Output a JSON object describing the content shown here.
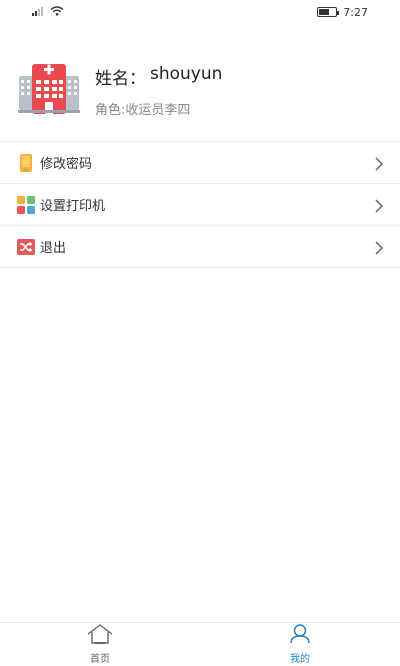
{
  "status_bar": {
    "time": "7:27",
    "signal_icon": "signal-icon",
    "wifi_icon": "wifi-icon",
    "battery_level": 0.6
  },
  "profile": {
    "avatar_icon": "hospital-icon",
    "name_label": "姓名：",
    "name_value": "shouyun",
    "role_text": "角色:收运员李四"
  },
  "menu": {
    "items": [
      {
        "label": "修改密码",
        "icon": "phone-icon"
      },
      {
        "label": "设置打印机",
        "icon": "grid-icon"
      },
      {
        "label": "退出",
        "icon": "shuffle-icon"
      }
    ]
  },
  "tab_bar": {
    "tabs": [
      {
        "label": "首页",
        "icon": "home-icon",
        "active": false
      },
      {
        "label": "我的",
        "icon": "user-icon",
        "active": true
      }
    ]
  },
  "colors": {
    "accent": "#2b7ec1",
    "hospital_red": "#e84a4f",
    "phone_yellow": "#f1b437",
    "exit_red": "#e05a5a"
  }
}
